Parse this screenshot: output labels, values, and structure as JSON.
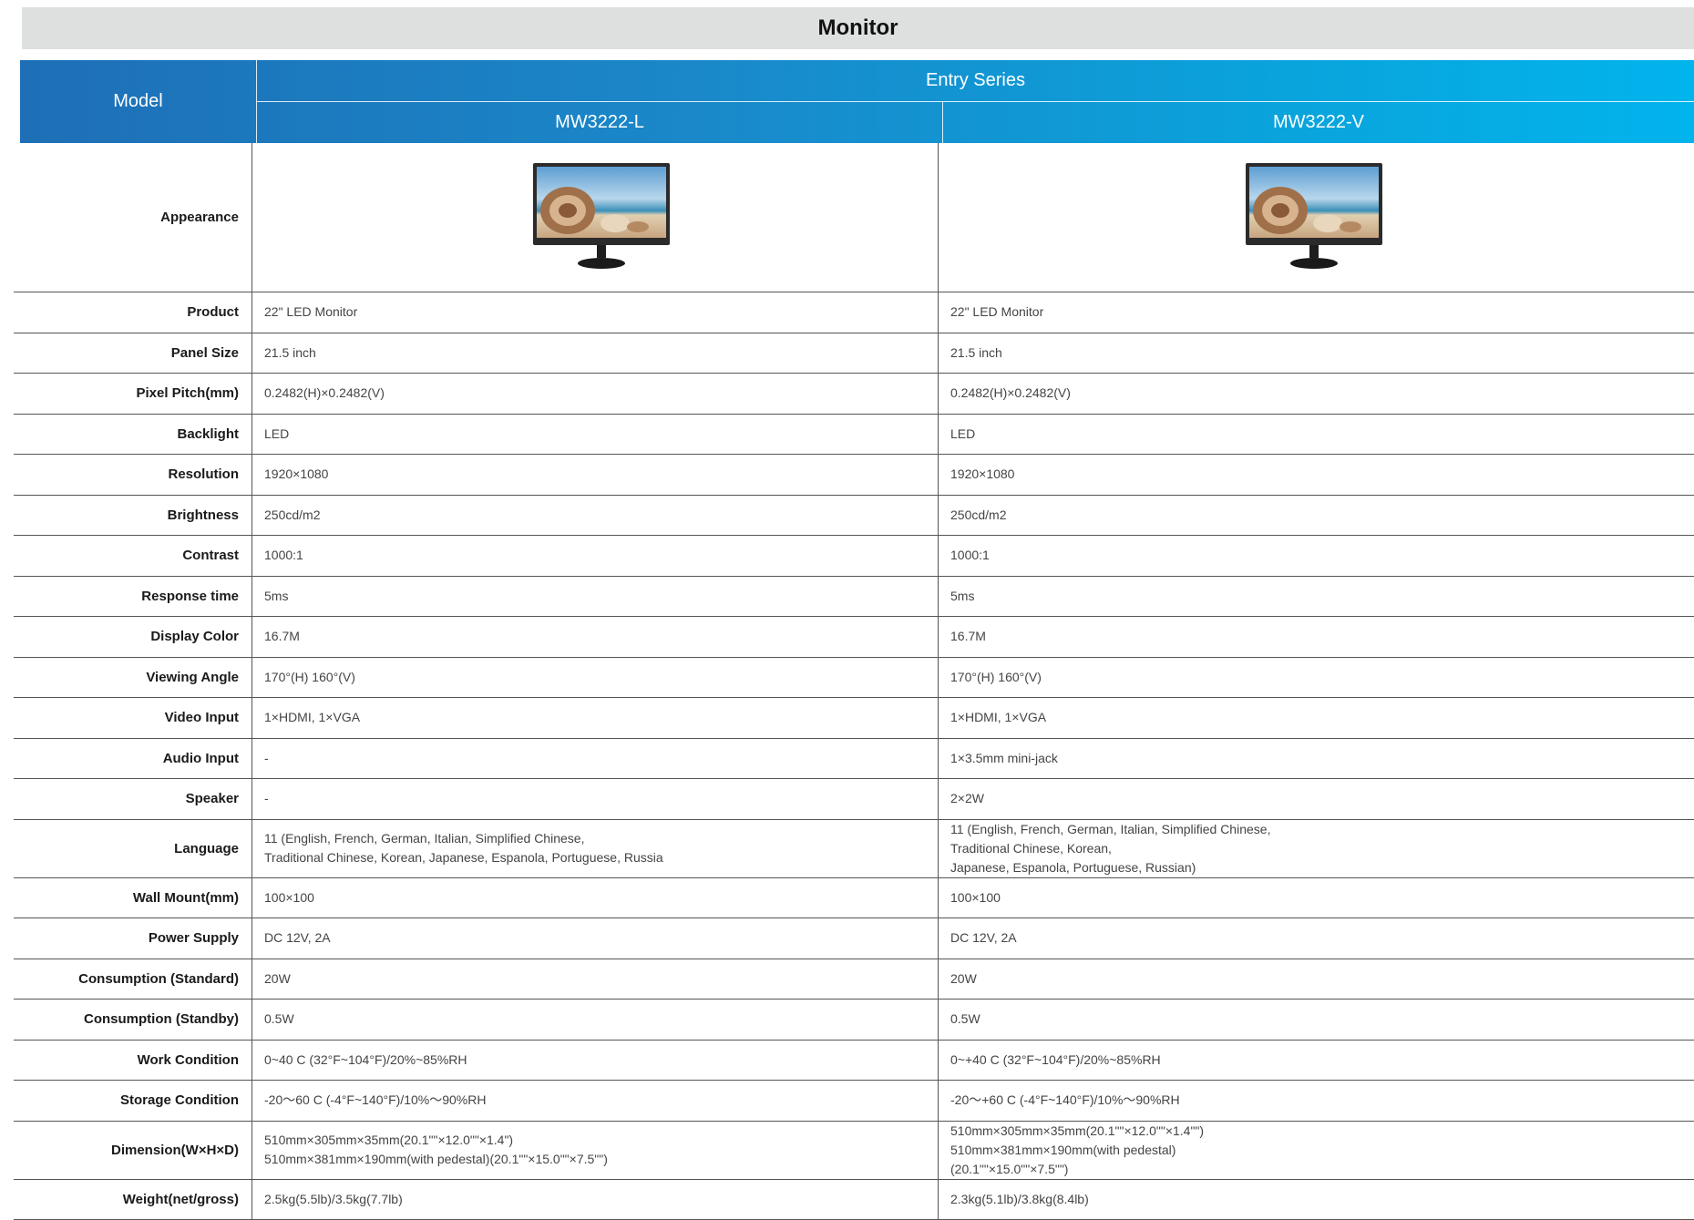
{
  "page_title": "Monitor",
  "header": {
    "model_label": "Model",
    "series_label": "Entry Series",
    "models": [
      "MW3222-L",
      "MW3222-V"
    ]
  },
  "appearance": {
    "label": "Appearance",
    "images": [
      "monitor-image",
      "monitor-image"
    ]
  },
  "rows": [
    {
      "label": "Product",
      "v1": [
        "22\" LED Monitor"
      ],
      "v2": [
        "22\" LED Monitor"
      ]
    },
    {
      "label": "Panel Size",
      "v1": [
        "21.5 inch"
      ],
      "v2": [
        "21.5 inch"
      ]
    },
    {
      "label": "Pixel Pitch(mm)",
      "v1": [
        "0.2482(H)×0.2482(V)"
      ],
      "v2": [
        "0.2482(H)×0.2482(V)"
      ]
    },
    {
      "label": "Backlight",
      "v1": [
        "LED"
      ],
      "v2": [
        "LED"
      ]
    },
    {
      "label": "Resolution",
      "v1": [
        "1920×1080"
      ],
      "v2": [
        "1920×1080"
      ]
    },
    {
      "label": "Brightness",
      "v1": [
        "250cd/m2"
      ],
      "v2": [
        "250cd/m2"
      ]
    },
    {
      "label": "Contrast",
      "v1": [
        "1000:1"
      ],
      "v2": [
        "1000:1"
      ]
    },
    {
      "label": "Response time",
      "v1": [
        "5ms"
      ],
      "v2": [
        "5ms"
      ]
    },
    {
      "label": "Display Color",
      "v1": [
        "16.7M"
      ],
      "v2": [
        "16.7M"
      ]
    },
    {
      "label": "Viewing Angle",
      "v1": [
        "170°(H) 160°(V)"
      ],
      "v2": [
        "170°(H) 160°(V)"
      ]
    },
    {
      "label": "Video Input",
      "v1": [
        "1×HDMI, 1×VGA"
      ],
      "v2": [
        "1×HDMI, 1×VGA"
      ]
    },
    {
      "label": "Audio Input",
      "v1": [
        "-"
      ],
      "v2": [
        "1×3.5mm mini-jack"
      ]
    },
    {
      "label": "Speaker",
      "v1": [
        "-"
      ],
      "v2": [
        "2×2W"
      ]
    },
    {
      "label": "Language",
      "v1": [
        "11 (English, French, German, Italian, Simplified Chinese,",
        "Traditional Chinese, Korean, Japanese, Espanola, Portuguese, Russia"
      ],
      "v2": [
        "11 (English, French, German, Italian, Simplified Chinese,",
        "Traditional Chinese, Korean,",
        "Japanese, Espanola, Portuguese, Russian)"
      ]
    },
    {
      "label": "Wall Mount(mm)",
      "v1": [
        "100×100"
      ],
      "v2": [
        "100×100"
      ]
    },
    {
      "label": "Power Supply",
      "v1": [
        "DC 12V, 2A"
      ],
      "v2": [
        "DC 12V, 2A"
      ]
    },
    {
      "label": "Consumption (Standard)",
      "v1": [
        "20W"
      ],
      "v2": [
        "20W"
      ]
    },
    {
      "label": "Consumption (Standby)",
      "v1": [
        "0.5W"
      ],
      "v2": [
        "0.5W"
      ]
    },
    {
      "label": "Work Condition",
      "v1": [
        "0~40 C (32°F~104°F)/20%~85%RH"
      ],
      "v2": [
        "0~+40 C (32°F~104°F)/20%~85%RH"
      ]
    },
    {
      "label": "Storage Condition",
      "v1": [
        "-20～60 C (-4°F~140°F)/10%～90%RH"
      ],
      "v2": [
        "-20～+60 C (-4°F~140°F)/10%～90%RH"
      ]
    },
    {
      "label": "Dimension(W×H×D)",
      "v1": [
        "510mm×305mm×35mm(20.1\"\"×12.0\"\"×1.4\")",
        "510mm×381mm×190mm(with pedestal)(20.1\"\"×15.0\"\"×7.5\"\")"
      ],
      "v2": [
        "510mm×305mm×35mm(20.1\"\"×12.0\"\"×1.4\"\")",
        "510mm×381mm×190mm(with pedestal)",
        "(20.1\"\"×15.0\"\"×7.5\"\")"
      ]
    },
    {
      "label": "Weight(net/gross)",
      "v1": [
        "2.5kg(5.5lb)/3.5kg(7.7lb)"
      ],
      "v2": [
        "2.3kg(5.1lb)/3.8kg(8.4lb)"
      ]
    }
  ],
  "colors": {
    "title_bg": "#dedfdf",
    "header_gradient_start": "#1e6fb6",
    "header_gradient_end": "#02b4ec"
  }
}
